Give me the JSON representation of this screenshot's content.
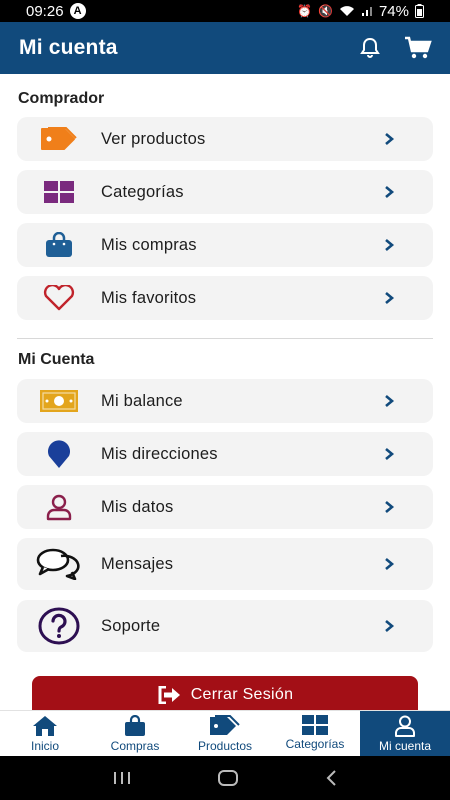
{
  "status": {
    "time": "09:26",
    "indicator": "A",
    "battery": "74%"
  },
  "header": {
    "title": "Mi cuenta"
  },
  "sections": {
    "buyer": {
      "title": "Comprador",
      "items": [
        {
          "label": "Ver productos",
          "icon": "tag-icon"
        },
        {
          "label": "Categorías",
          "icon": "grid-icon"
        },
        {
          "label": "Mis compras",
          "icon": "shopping-bag-icon"
        },
        {
          "label": "Mis favoritos",
          "icon": "heart-icon"
        }
      ]
    },
    "account": {
      "title": "Mi Cuenta",
      "items": [
        {
          "label": "Mi balance",
          "icon": "money-icon"
        },
        {
          "label": "Mis direcciones",
          "icon": "map-pin-icon"
        },
        {
          "label": "Mis datos",
          "icon": "user-icon"
        },
        {
          "label": "Mensajes",
          "icon": "chat-icon"
        },
        {
          "label": "Soporte",
          "icon": "help-icon"
        }
      ]
    }
  },
  "logout": {
    "label": "Cerrar Sesión"
  },
  "bottom_nav": [
    {
      "label": "Inicio",
      "icon": "home-icon",
      "active": false
    },
    {
      "label": "Compras",
      "icon": "shopping-bag-icon",
      "active": false
    },
    {
      "label": "Productos",
      "icon": "tags-icon",
      "active": false
    },
    {
      "label": "Categorías",
      "icon": "grid-icon",
      "active": false
    },
    {
      "label": "Mi cuenta",
      "icon": "user-icon",
      "active": true
    }
  ],
  "colors": {
    "primary": "#114a7c",
    "danger": "#a30f16",
    "tag": "#f07f1a",
    "grid": "#7a2a7e",
    "bag": "#1f5f96",
    "heart": "#c0232b",
    "money": "#e3a51d",
    "pin": "#1a3f9a",
    "user": "#8a1f4b",
    "help": "#2d0f52"
  }
}
